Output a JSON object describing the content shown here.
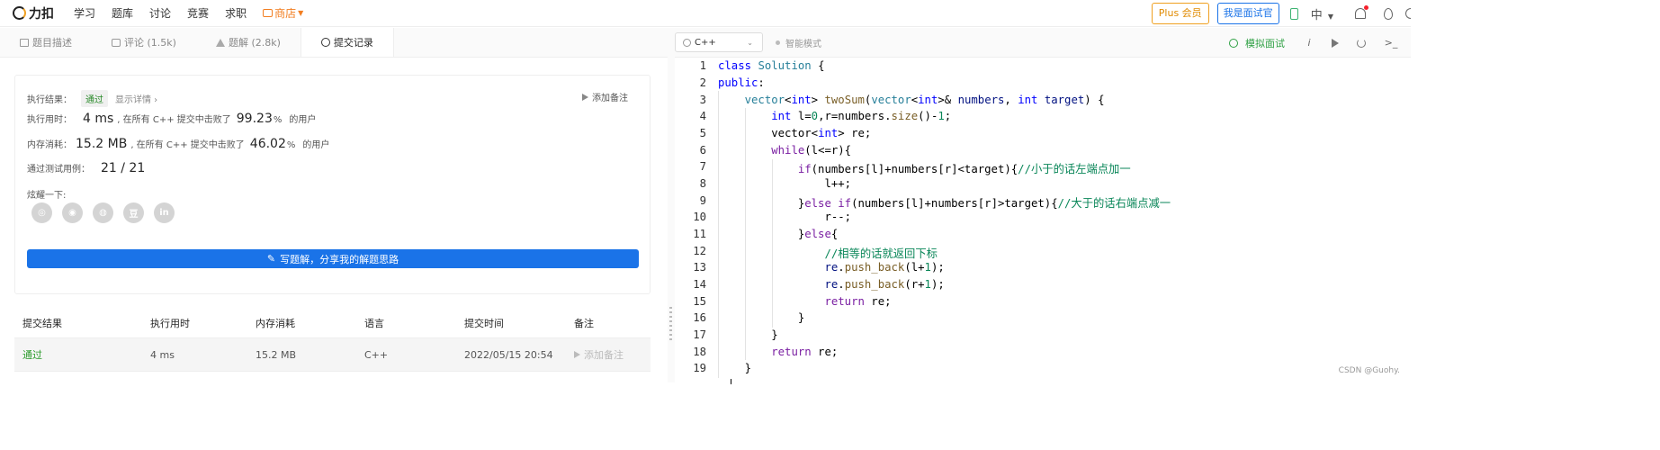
{
  "nav": {
    "logo_text": "力扣",
    "links": [
      "学习",
      "题库",
      "讨论",
      "竞赛",
      "求职"
    ],
    "shop": "商店",
    "plus": "Plus 会员",
    "interviewer": "我是面试官",
    "lang": "中"
  },
  "tabs": [
    {
      "label": "题目描述",
      "icon": "document-icon"
    },
    {
      "label": "评论 (1.5k)",
      "icon": "comment-icon"
    },
    {
      "label": "题解 (2.8k)",
      "icon": "flask-icon"
    },
    {
      "label": "提交记录",
      "icon": "clock-icon"
    }
  ],
  "result": {
    "label_result": "执行结果：",
    "status": "通过",
    "detail": "显示详情 ›",
    "add_note": "添加备注",
    "label_time": "执行用时：",
    "time": "4 ms",
    "beat_prefix": ", 在所有 C++ 提交中击败了",
    "time_pct": "99.23",
    "pct_sign": "%",
    "user_suffix": "的用户",
    "label_mem": "内存消耗：",
    "mem": "15.2 MB",
    "mem_pct": "46.02",
    "label_tests": "通过测试用例：",
    "tests": "21 / 21",
    "label_share": "炫耀一下:",
    "share_icons": [
      "wechat-icon",
      "weibo-icon",
      "qq-icon",
      "douban-icon",
      "linkedin-icon"
    ],
    "share_glyphs": [
      "◎",
      "◉",
      "◍",
      "豆",
      "in"
    ],
    "write_btn": "写题解，分享我的解题思路"
  },
  "table": {
    "headers": [
      "提交结果",
      "执行用时",
      "内存消耗",
      "语言",
      "提交时间",
      "备注"
    ],
    "row": {
      "result": "通过",
      "time": "4 ms",
      "mem": "15.2 MB",
      "lang": "C++",
      "submitted": "2022/05/15 20:54",
      "note": "添加备注"
    }
  },
  "editor": {
    "language": "C++",
    "smart_mode": "智能模式",
    "mock": "模拟面试",
    "tool_info": "i",
    "tool_console": ">_",
    "watermark": "CSDN @Guohy."
  },
  "code_lines": [
    "1",
    "2",
    "3",
    "4",
    "5",
    "6",
    "7",
    "8",
    "9",
    "10",
    "11",
    "12",
    "13",
    "14",
    "15",
    "16",
    "17",
    "18",
    "19"
  ],
  "colors": {
    "accent": "#1a73e8",
    "pass_green": "#2a9a2a",
    "plus_orange": "#f0a020",
    "keyword": "#7a1fa2",
    "type": "#0000ff",
    "comment_green": "#098658"
  }
}
